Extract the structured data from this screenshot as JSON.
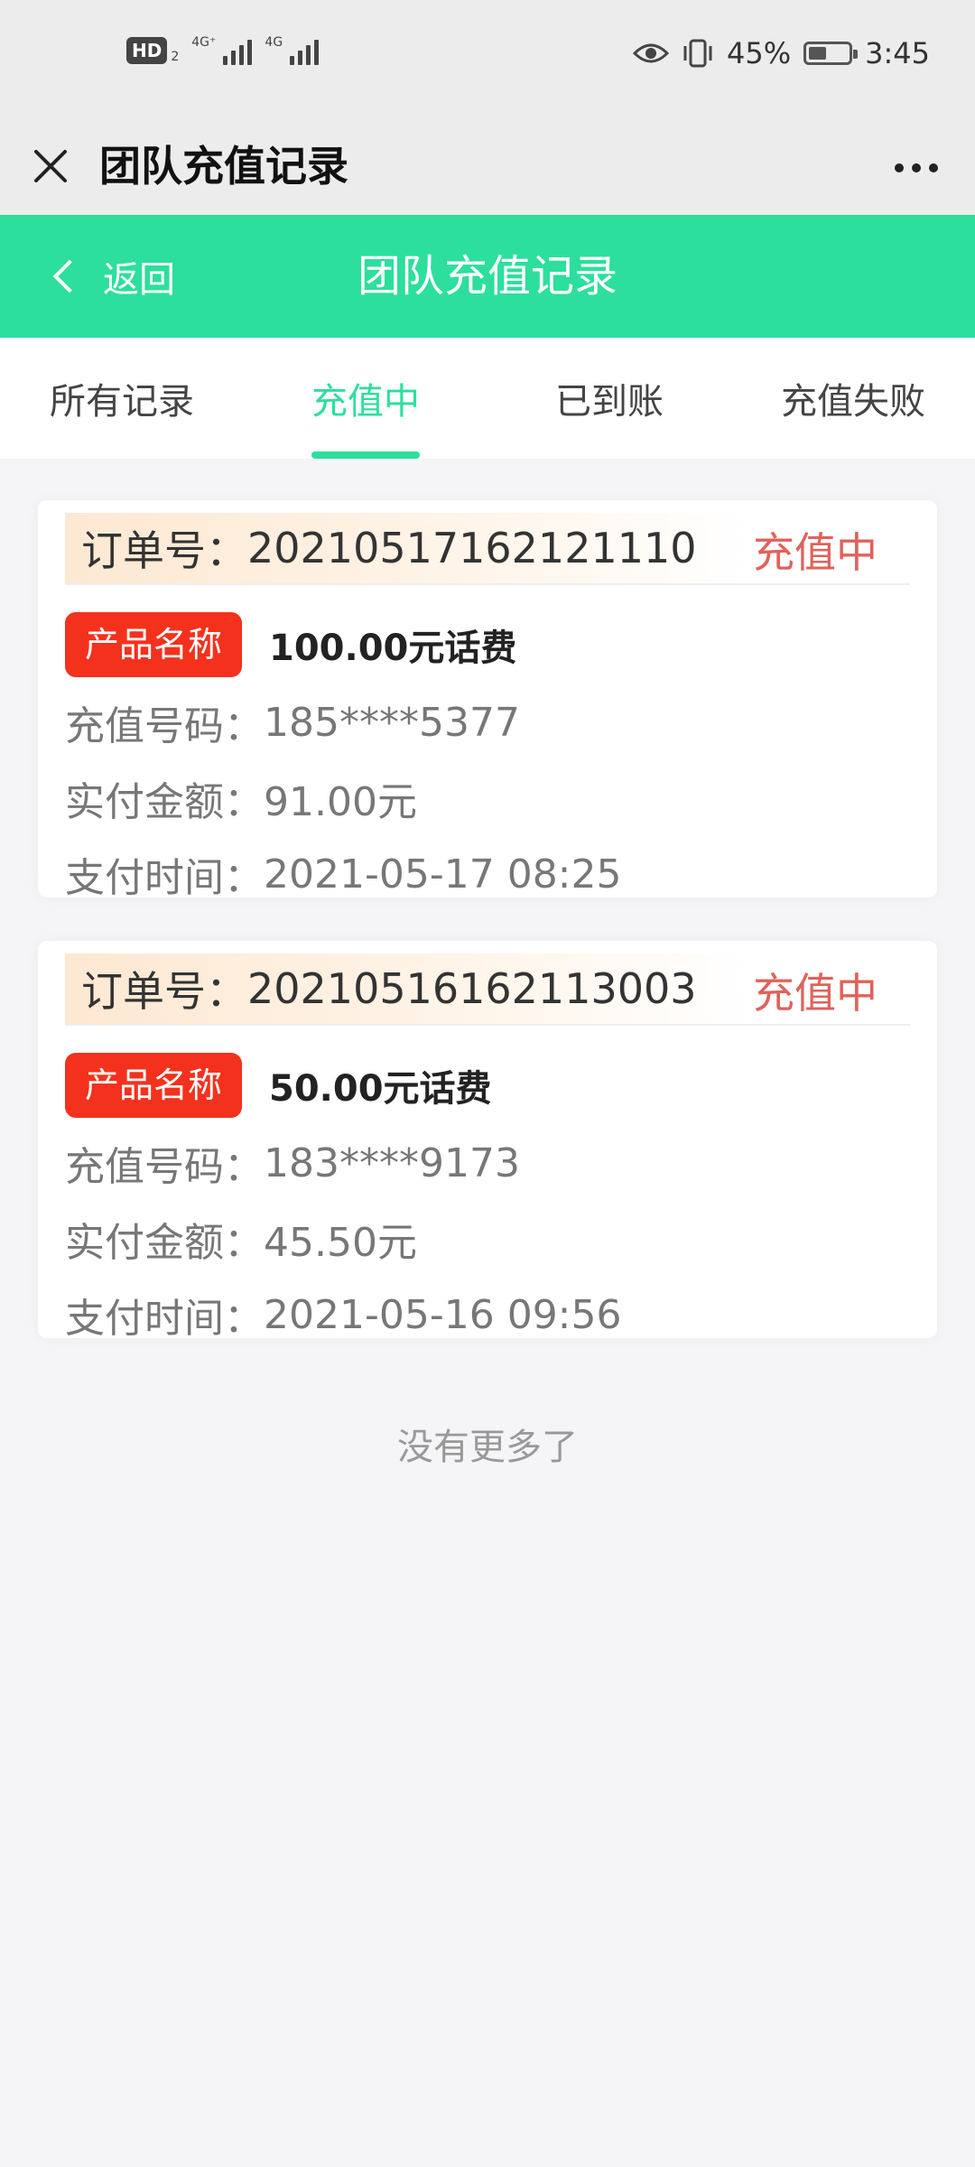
{
  "status_bar": {
    "hd": "HD",
    "hd_sub": "2",
    "net1": "4G⁺",
    "net2": "4G",
    "battery_percent": "45%",
    "battery_level": 0.45,
    "time": "3:45"
  },
  "wx_bar": {
    "title": "团队充值记录"
  },
  "header": {
    "back_label": "返回",
    "title": "团队充值记录"
  },
  "tabs": [
    {
      "label": "所有记录"
    },
    {
      "label": "充值中"
    },
    {
      "label": "已到账"
    },
    {
      "label": "充值失败"
    }
  ],
  "active_tab_index": 1,
  "orders": [
    {
      "order_label": "订单号：",
      "order_no": "20210517162121110",
      "status": "充值中",
      "product_tag": "产品名称",
      "product_name": "100.00元话费",
      "phone_label": "充值号码：",
      "phone": "185****5377",
      "paid_label": "实付金额：",
      "paid": "91.00元",
      "time_label": "支付时间：",
      "time": "2021-05-17 08:25"
    },
    {
      "order_label": "订单号：",
      "order_no": "20210516162113003",
      "status": "充值中",
      "product_tag": "产品名称",
      "product_name": "50.00元话费",
      "phone_label": "充值号码：",
      "phone": "183****9173",
      "paid_label": "实付金额：",
      "paid": "45.50元",
      "time_label": "支付时间：",
      "time": "2021-05-16 09:56"
    }
  ],
  "no_more": "没有更多了",
  "colors": {
    "green": "#2ddf9c",
    "status_red": "#e0625a",
    "tag_red": "#f4311d"
  }
}
